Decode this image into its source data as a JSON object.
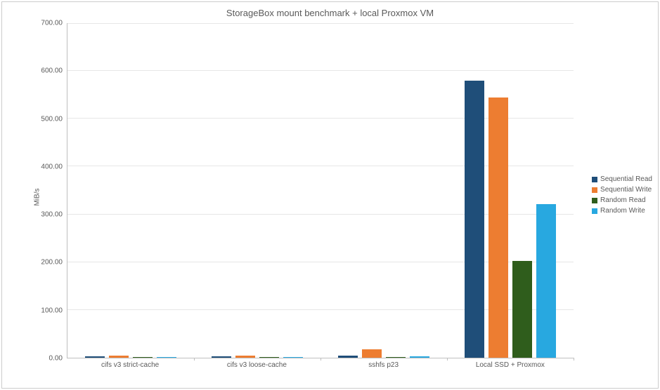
{
  "chart_data": {
    "type": "bar",
    "title": "StorageBox mount benchmark + local Proxmox VM",
    "ylabel": "MiB/s",
    "xlabel": "",
    "ylim": [
      0,
      700
    ],
    "yticks": [
      "0.00",
      "100.00",
      "200.00",
      "300.00",
      "400.00",
      "500.00",
      "600.00",
      "700.00"
    ],
    "categories": [
      "cifs v3 strict-cache",
      "cifs v3 loose-cache",
      "sshfs p23",
      "Local SSD + Proxmox"
    ],
    "series": [
      {
        "name": "Sequential Read",
        "color": "#1f4e79",
        "values": [
          3,
          3,
          5,
          580
        ]
      },
      {
        "name": "Sequential Write",
        "color": "#ed7d31",
        "values": [
          4,
          4,
          18,
          545
        ]
      },
      {
        "name": "Random Read",
        "color": "#2f5d1c",
        "values": [
          2,
          2,
          2,
          202
        ]
      },
      {
        "name": "Random Write",
        "color": "#28a8e0",
        "values": [
          2,
          2,
          3,
          322
        ]
      }
    ]
  }
}
